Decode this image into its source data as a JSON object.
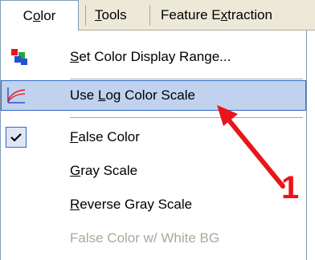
{
  "menubar": {
    "color": {
      "pre": "C",
      "ul": "o",
      "post": "lor"
    },
    "tools": {
      "pre": "",
      "ul": "T",
      "post": "ools"
    },
    "feature_extraction": {
      "pre": "Feature E",
      "ul": "x",
      "post": "traction"
    }
  },
  "menu": {
    "items": [
      {
        "pre": "",
        "ul": "S",
        "post": "et Color Display Range..."
      },
      {
        "pre": "Use ",
        "ul": "L",
        "post": "og Color Scale"
      },
      {
        "pre": "",
        "ul": "F",
        "post": "alse Color"
      },
      {
        "pre": "",
        "ul": "G",
        "post": "ray Scale"
      },
      {
        "pre": "",
        "ul": "R",
        "post": "everse Gray Scale"
      },
      {
        "pre": "False Color w/ White BG",
        "ul": "",
        "post": ""
      }
    ]
  },
  "annotation": {
    "number": "1",
    "color": "#e8151b"
  },
  "colors": {
    "highlight": "#c1d2ee",
    "highlight_border": "#316ac5",
    "menubar": "#ece9d8"
  }
}
